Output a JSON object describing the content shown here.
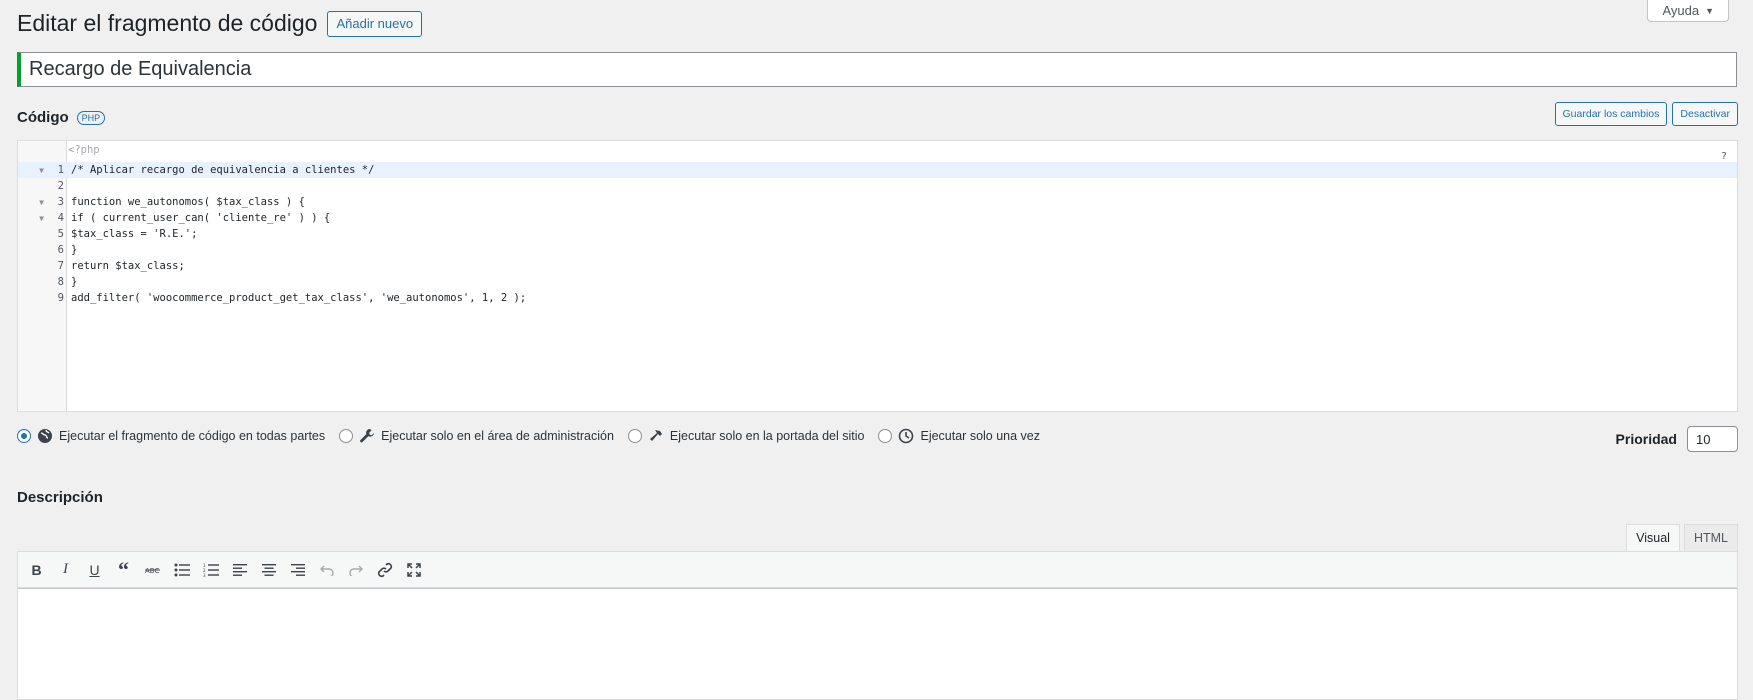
{
  "help": {
    "label": "Ayuda"
  },
  "header": {
    "title": "Editar el fragmento de código",
    "add_new": "Añadir nuevo"
  },
  "snippet": {
    "title_value": "Recargo de Equivalencia"
  },
  "code_section": {
    "label": "Código",
    "badge": "PHP",
    "save_button": "Guardar los cambios",
    "deactivate_button": "Desactivar",
    "php_open_tag": "<?php",
    "help_marker": "?",
    "lines": [
      {
        "n": "1",
        "text": "/* Aplicar recargo de equivalencia a clientes */"
      },
      {
        "n": "2",
        "text": ""
      },
      {
        "n": "3",
        "text": "function we_autonomos( $tax_class ) {"
      },
      {
        "n": "4",
        "text": "if ( current_user_can( 'cliente_re' ) ) {"
      },
      {
        "n": "5",
        "text": "$tax_class = 'R.E.';"
      },
      {
        "n": "6",
        "text": "}"
      },
      {
        "n": "7",
        "text": "return $tax_class;"
      },
      {
        "n": "8",
        "text": "}"
      },
      {
        "n": "9",
        "text": "add_filter( 'woocommerce_product_get_tax_class', 'we_autonomos', 1, 2 );"
      }
    ]
  },
  "scope": {
    "options": [
      {
        "label": "Ejecutar el fragmento de código en todas partes",
        "icon": "globe-icon",
        "checked": true
      },
      {
        "label": "Ejecutar solo en el área de administración",
        "icon": "wrench-icon",
        "checked": false
      },
      {
        "label": "Ejecutar solo en la portada del sitio",
        "icon": "hammer-icon",
        "checked": false
      },
      {
        "label": "Ejecutar solo una vez",
        "icon": "clock-icon",
        "checked": false
      }
    ]
  },
  "priority": {
    "label": "Prioridad",
    "value": "10"
  },
  "description": {
    "label": "Descripción",
    "tabs": [
      "Visual",
      "HTML"
    ],
    "active_tab": "Visual",
    "toolbar": [
      "bold",
      "italic",
      "underline",
      "blockquote",
      "strikethrough",
      "bullet-list",
      "numbered-list",
      "align-left",
      "align-center",
      "align-right",
      "undo",
      "redo",
      "link",
      "fullscreen"
    ]
  },
  "colors": {
    "accent": "#2271b1",
    "active_border": "#00a32a",
    "background": "#f0f0f1"
  }
}
